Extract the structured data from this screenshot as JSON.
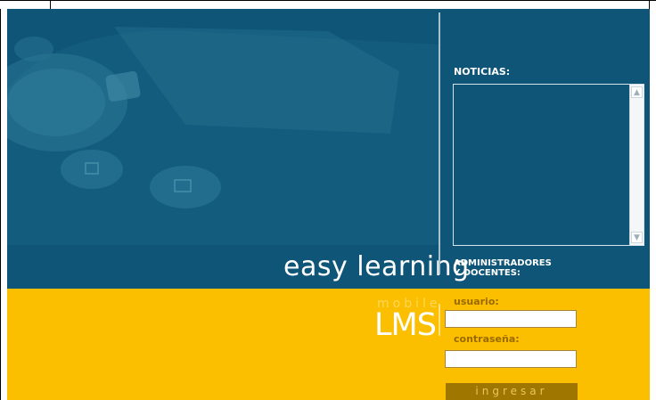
{
  "brand": {
    "tagline": "easy learning",
    "product_prefix": "mobile",
    "product_name": "LMS"
  },
  "news": {
    "label": "NOTICIAS:",
    "content": ""
  },
  "login": {
    "section_label_line1": "ADMINISTRADORES",
    "section_label_line2": "Y DOCENTES:",
    "user_label": "usuario:",
    "user_value": "",
    "password_label": "contraseña:",
    "password_value": "",
    "submit_label": "ingresar"
  },
  "colors": {
    "teal": "#0f5578",
    "yellow": "#fbbf00",
    "button": "#9f7700"
  }
}
